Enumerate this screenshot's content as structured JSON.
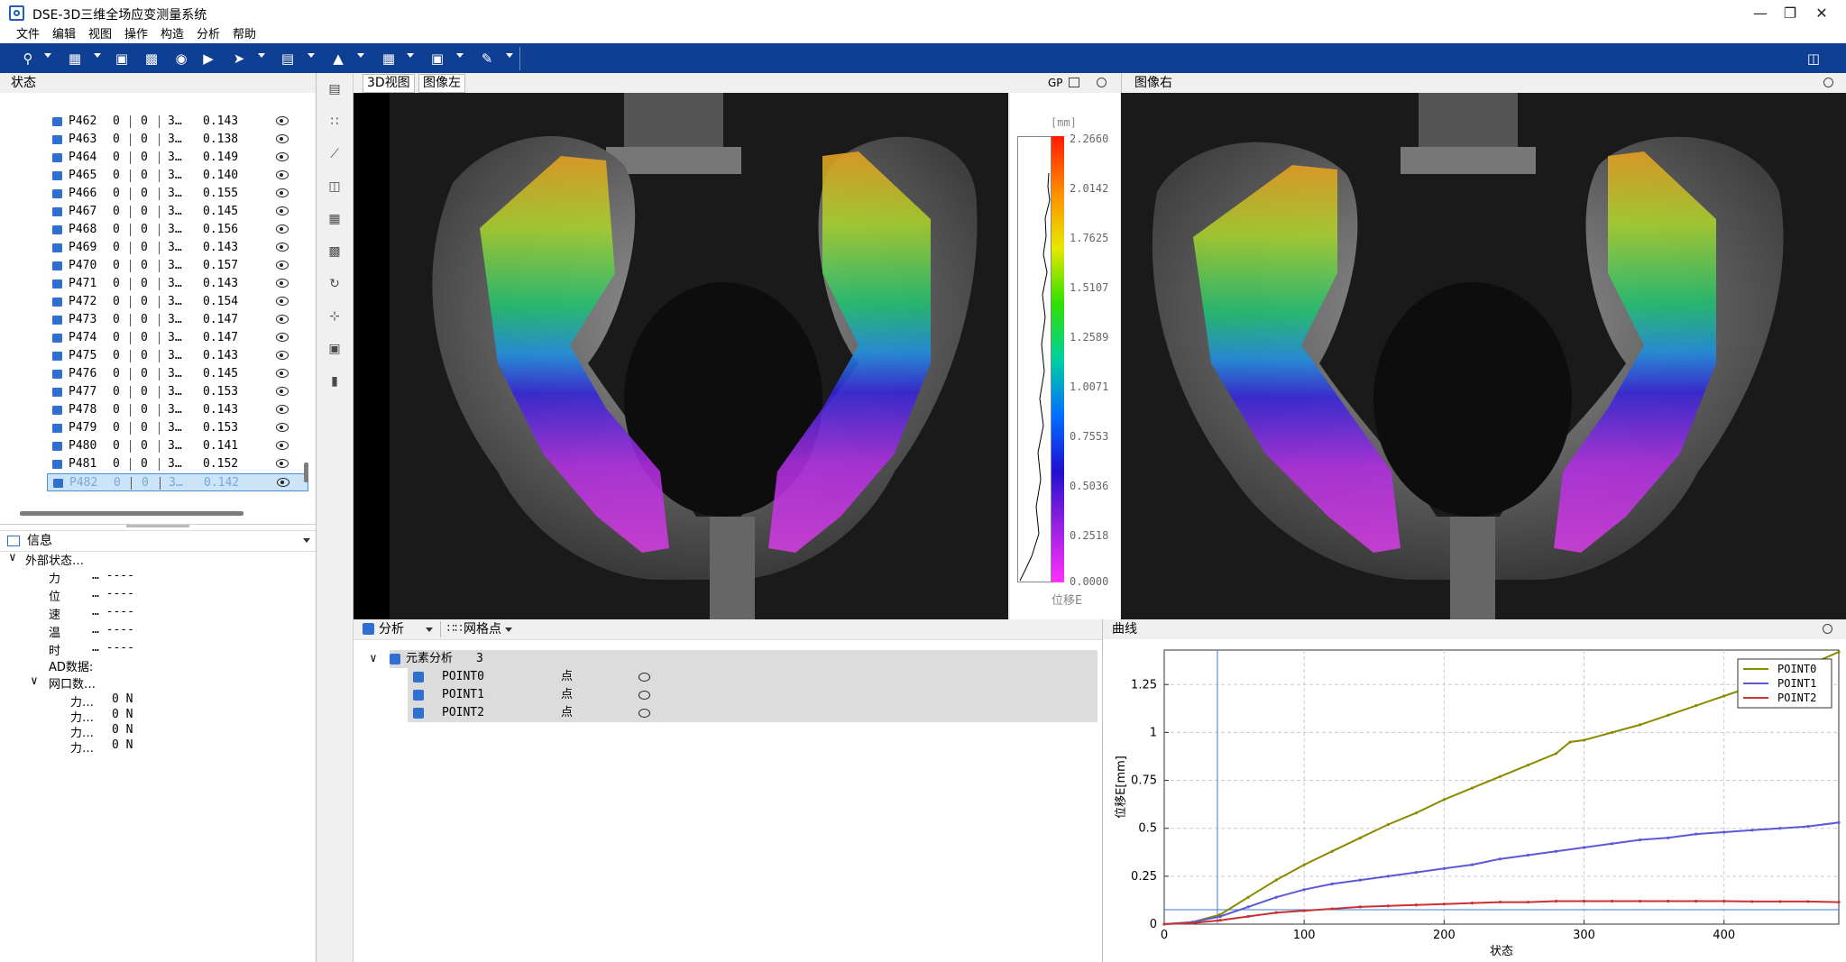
{
  "title_bar": {
    "title": "DSE-3D三维全场应变测量系统",
    "minimize": "—",
    "restore": "❐",
    "close": "✕"
  },
  "menu": [
    "文件",
    "编辑",
    "视图",
    "操作",
    "构造",
    "分析",
    "帮助"
  ],
  "toolbar": {
    "icons": [
      "search-icon",
      "grid-icon",
      "export-icon",
      "image-icon",
      "record-icon",
      "play-icon",
      "pointer-icon",
      "layers-icon",
      "stage-icon",
      "table-icon",
      "frame-icon",
      "brush-icon"
    ]
  },
  "status_panel": {
    "header": "状态",
    "rows": [
      {
        "name": "P462",
        "a": "0",
        "b": "0",
        "c": "3…",
        "value": "0.143"
      },
      {
        "name": "P463",
        "a": "0",
        "b": "0",
        "c": "3…",
        "value": "0.138"
      },
      {
        "name": "P464",
        "a": "0",
        "b": "0",
        "c": "3…",
        "value": "0.149"
      },
      {
        "name": "P465",
        "a": "0",
        "b": "0",
        "c": "3…",
        "value": "0.140"
      },
      {
        "name": "P466",
        "a": "0",
        "b": "0",
        "c": "3…",
        "value": "0.155"
      },
      {
        "name": "P467",
        "a": "0",
        "b": "0",
        "c": "3…",
        "value": "0.145"
      },
      {
        "name": "P468",
        "a": "0",
        "b": "0",
        "c": "3…",
        "value": "0.156"
      },
      {
        "name": "P469",
        "a": "0",
        "b": "0",
        "c": "3…",
        "value": "0.143"
      },
      {
        "name": "P470",
        "a": "0",
        "b": "0",
        "c": "3…",
        "value": "0.157"
      },
      {
        "name": "P471",
        "a": "0",
        "b": "0",
        "c": "3…",
        "value": "0.143"
      },
      {
        "name": "P472",
        "a": "0",
        "b": "0",
        "c": "3…",
        "value": "0.154"
      },
      {
        "name": "P473",
        "a": "0",
        "b": "0",
        "c": "3…",
        "value": "0.147"
      },
      {
        "name": "P474",
        "a": "0",
        "b": "0",
        "c": "3…",
        "value": "0.147"
      },
      {
        "name": "P475",
        "a": "0",
        "b": "0",
        "c": "3…",
        "value": "0.143"
      },
      {
        "name": "P476",
        "a": "0",
        "b": "0",
        "c": "3…",
        "value": "0.145"
      },
      {
        "name": "P477",
        "a": "0",
        "b": "0",
        "c": "3…",
        "value": "0.153"
      },
      {
        "name": "P478",
        "a": "0",
        "b": "0",
        "c": "3…",
        "value": "0.143"
      },
      {
        "name": "P479",
        "a": "0",
        "b": "0",
        "c": "3…",
        "value": "0.153"
      },
      {
        "name": "P480",
        "a": "0",
        "b": "0",
        "c": "3…",
        "value": "0.141"
      },
      {
        "name": "P481",
        "a": "0",
        "b": "0",
        "c": "3…",
        "value": "0.152"
      },
      {
        "name": "P482",
        "a": "0",
        "b": "0",
        "c": "3…",
        "value": "0.142"
      }
    ]
  },
  "info_panel": {
    "header": "信息",
    "external_state": "外部状态…",
    "external_items": [
      {
        "label": "力",
        "value": "… ----"
      },
      {
        "label": "位",
        "value": "… ----"
      },
      {
        "label": "速",
        "value": "… ----"
      },
      {
        "label": "温",
        "value": "… ----"
      },
      {
        "label": "时",
        "value": "… ----"
      }
    ],
    "ad_data": "AD数据:",
    "port_data": "网口数…",
    "port_items": [
      {
        "label": "力…",
        "value": "0 N"
      },
      {
        "label": "力…",
        "value": "0 N"
      },
      {
        "label": "力…",
        "value": "0 N"
      },
      {
        "label": "力…",
        "value": "0 N"
      }
    ]
  },
  "left_view": {
    "tabs": [
      "3D视图",
      "图像左"
    ],
    "gp_label": "GP",
    "colorbar": {
      "unit": "[mm]",
      "title": "位移E",
      "ticks": [
        "2.2660",
        "2.0142",
        "1.7625",
        "1.5107",
        "1.2589",
        "1.0071",
        "0.7553",
        "0.5036",
        "0.2518",
        "0.0000"
      ]
    }
  },
  "right_view": {
    "title": "图像右"
  },
  "analysis_panel": {
    "tab_analysis": "分析",
    "tab_grid": "网格点",
    "tree": {
      "root_label": "元素分析",
      "root_count": "3",
      "items": [
        {
          "name": "POINT0",
          "type": "点"
        },
        {
          "name": "POINT1",
          "type": "点"
        },
        {
          "name": "POINT2",
          "type": "点"
        }
      ]
    }
  },
  "curve_panel": {
    "title": "曲线"
  },
  "chart_data": {
    "type": "line",
    "title": "",
    "xlabel": "状态",
    "ylabel": "位移E[mm]",
    "xlim": [
      0,
      482
    ],
    "ylim": [
      0,
      1.43
    ],
    "xticks": [
      0,
      100,
      200,
      300,
      400
    ],
    "yticks": [
      0,
      0.25,
      0.5,
      0.75,
      1,
      1.25
    ],
    "ytick_labels": [
      "0",
      "0.25",
      "0.5",
      "0.75",
      "1",
      "1.25"
    ],
    "grid": true,
    "legend_position": "top-right",
    "cursor_x": 38,
    "cursor_y": 0.075,
    "series": [
      {
        "name": "POINT0",
        "color": "#8a8a00",
        "x": [
          0,
          20,
          40,
          60,
          80,
          100,
          120,
          140,
          160,
          180,
          200,
          220,
          240,
          260,
          280,
          290,
          300,
          320,
          340,
          360,
          380,
          400,
          420,
          440,
          460,
          482
        ],
        "y": [
          0,
          0.01,
          0.05,
          0.14,
          0.23,
          0.31,
          0.38,
          0.45,
          0.52,
          0.58,
          0.65,
          0.71,
          0.77,
          0.83,
          0.89,
          0.95,
          0.96,
          1.0,
          1.04,
          1.09,
          1.14,
          1.19,
          1.24,
          1.3,
          1.35,
          1.42
        ]
      },
      {
        "name": "POINT1",
        "color": "#5a5ad8",
        "x": [
          0,
          20,
          40,
          60,
          80,
          100,
          120,
          140,
          160,
          180,
          200,
          220,
          240,
          260,
          280,
          300,
          320,
          340,
          360,
          380,
          400,
          420,
          440,
          460,
          482
        ],
        "y": [
          0,
          0.01,
          0.04,
          0.09,
          0.14,
          0.18,
          0.21,
          0.23,
          0.25,
          0.27,
          0.29,
          0.31,
          0.34,
          0.36,
          0.38,
          0.4,
          0.42,
          0.44,
          0.45,
          0.47,
          0.48,
          0.49,
          0.5,
          0.51,
          0.53
        ]
      },
      {
        "name": "POINT2",
        "color": "#c83232",
        "x": [
          0,
          20,
          40,
          60,
          80,
          100,
          120,
          140,
          160,
          180,
          200,
          220,
          240,
          260,
          280,
          300,
          320,
          340,
          360,
          380,
          400,
          420,
          440,
          460,
          482
        ],
        "y": [
          0,
          0.005,
          0.02,
          0.04,
          0.06,
          0.07,
          0.08,
          0.09,
          0.095,
          0.1,
          0.105,
          0.11,
          0.115,
          0.115,
          0.12,
          0.12,
          0.12,
          0.12,
          0.12,
          0.12,
          0.12,
          0.118,
          0.118,
          0.118,
          0.115
        ]
      }
    ]
  }
}
